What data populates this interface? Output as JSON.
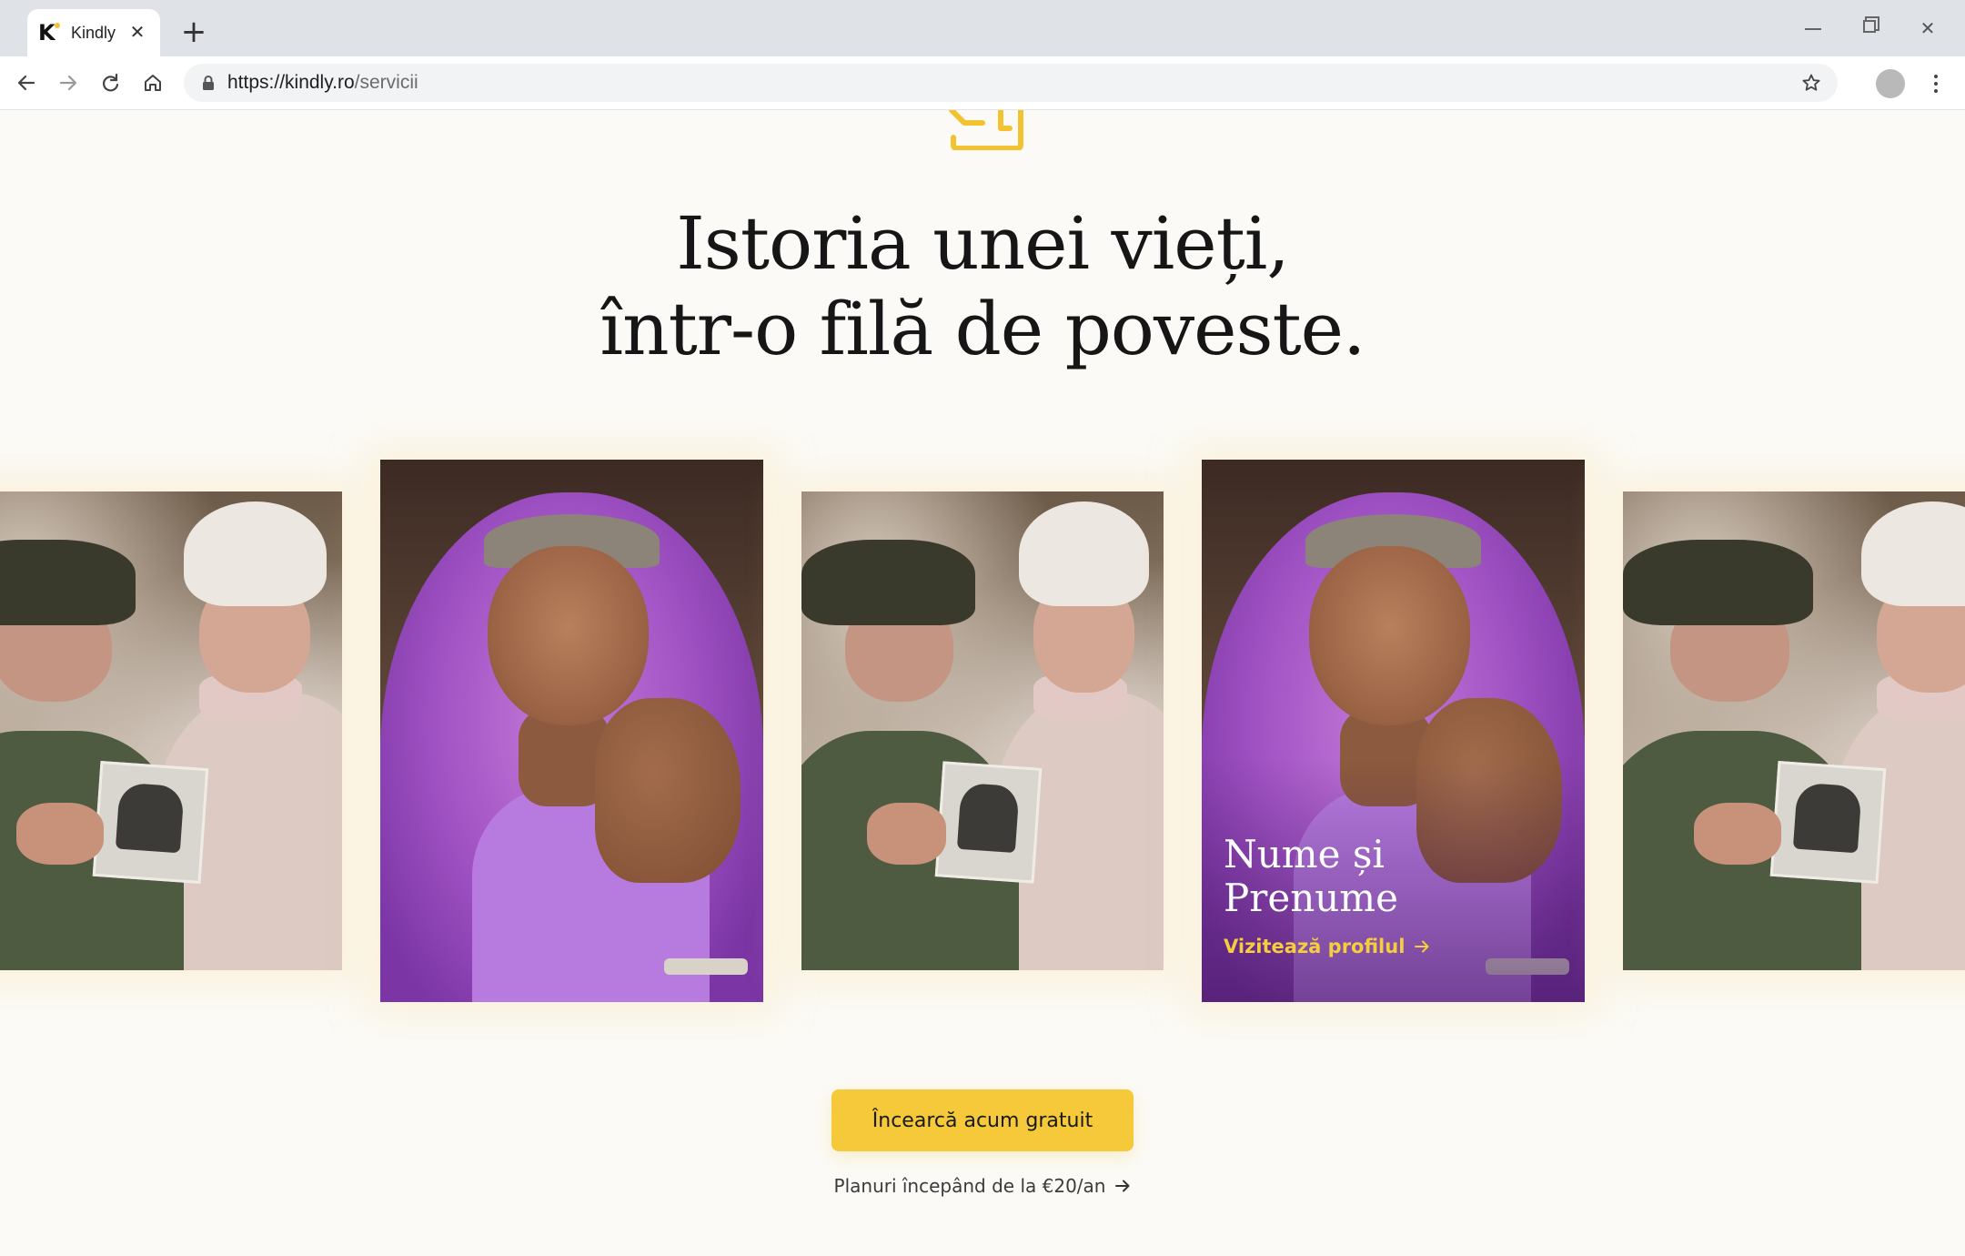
{
  "browser": {
    "tab_title": "Kindly",
    "favicon_letter": "K",
    "new_tab_symbol": "+",
    "url_host": "https://kindly.ro",
    "url_path": "/servicii",
    "icons": [
      "back-arrow-icon",
      "forward-arrow-icon",
      "reload-icon",
      "home-icon",
      "lock-icon",
      "star-icon",
      "menu-dots-icon"
    ]
  },
  "hero": {
    "headline_line1": "Istoria unei vieți,",
    "headline_line2": "într-o filă de poveste."
  },
  "featured": {
    "name": "Nume și Prenume",
    "link_label": "Vizitează profilul"
  },
  "cta": {
    "button_label": "Încearcă acum gratuit",
    "plans_label": "Planuri începând de la €20/an"
  },
  "colors": {
    "accent": "#f6c93a",
    "text": "#161616",
    "background": "#fbfaf6"
  }
}
